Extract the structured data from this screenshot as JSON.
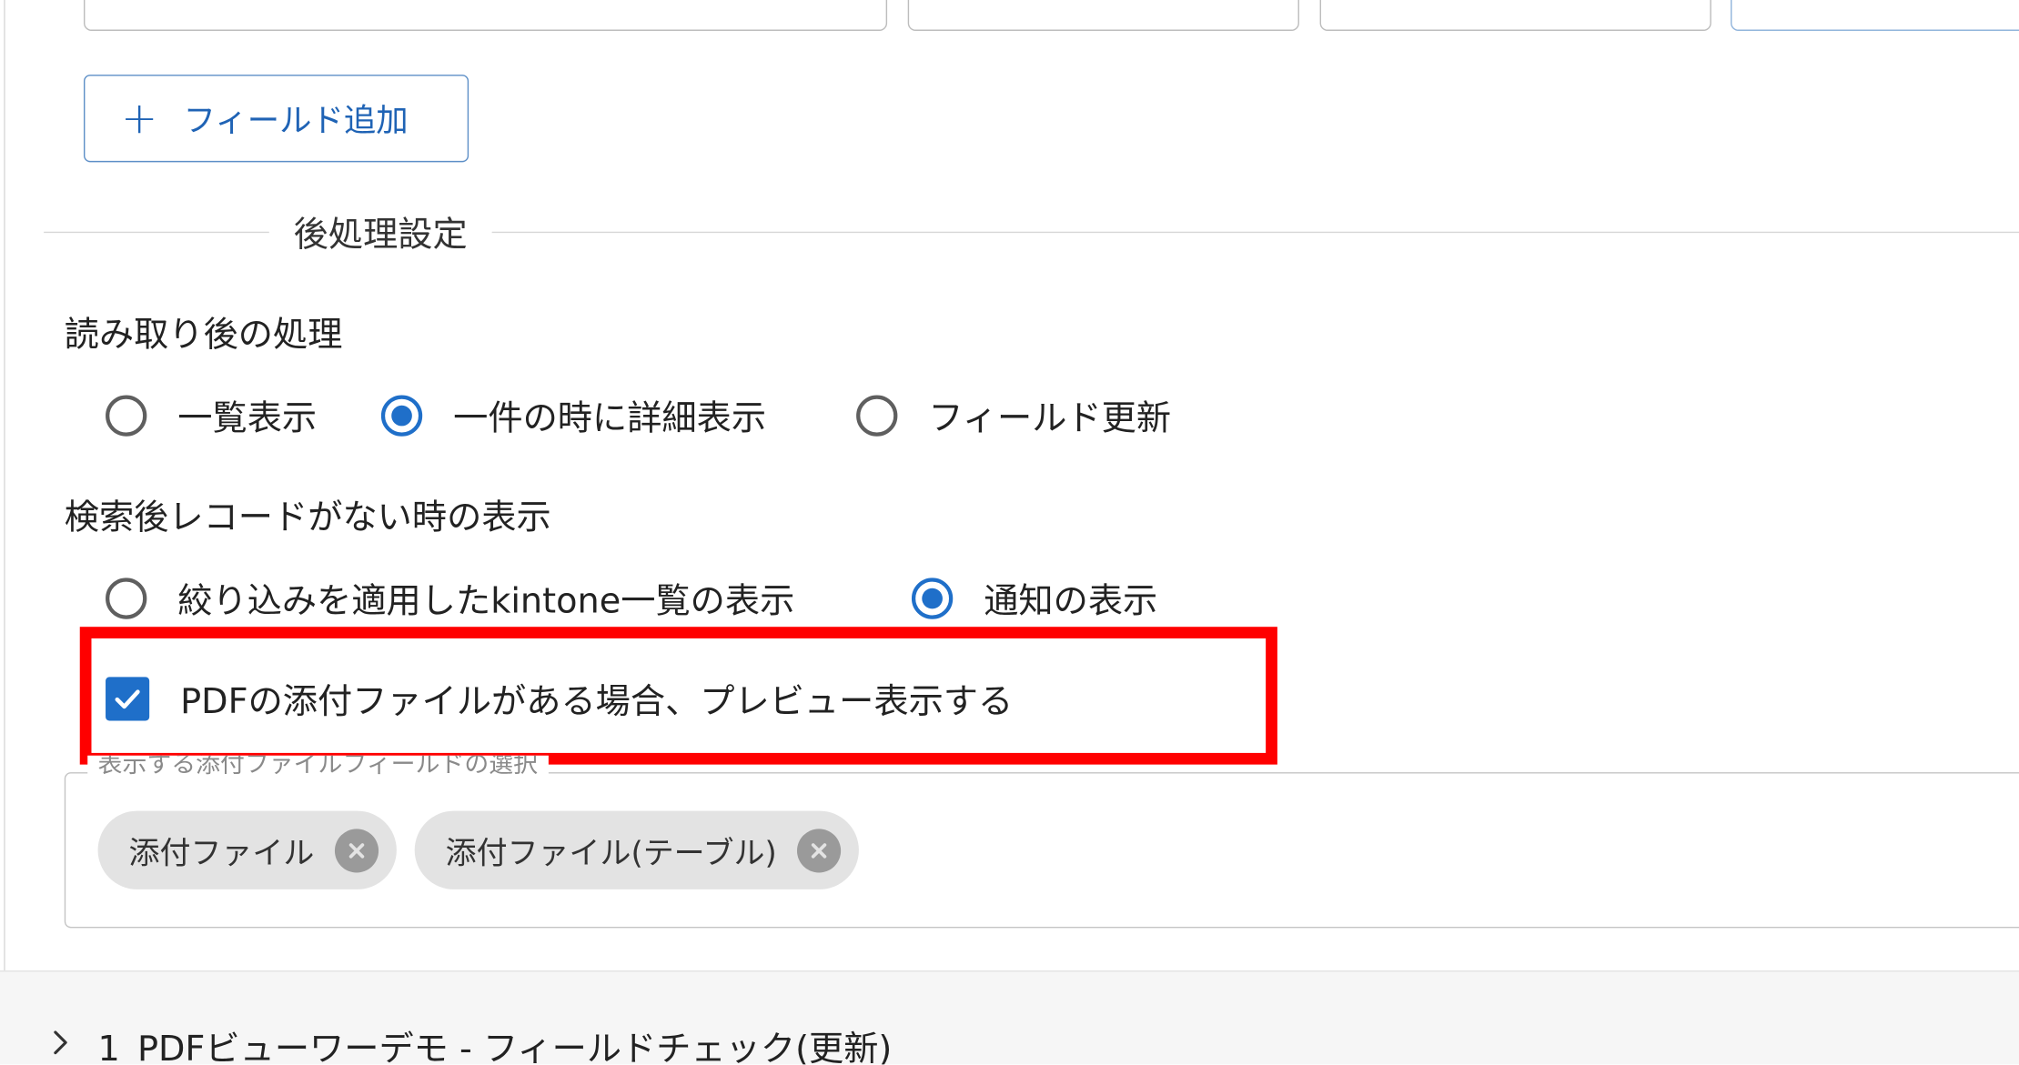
{
  "add_field_button": {
    "icon": "plus-icon",
    "label": "フィールド追加"
  },
  "post_processing": {
    "section_title": "後処理設定",
    "after_read": {
      "label": "読み取り後の処理",
      "options": [
        {
          "label": "一覧表示",
          "selected": false
        },
        {
          "label": "一件の時に詳細表示",
          "selected": true
        },
        {
          "label": "フィールド更新",
          "selected": false
        }
      ]
    },
    "no_record": {
      "label": "検索後レコードがない時の表示",
      "options": [
        {
          "label": "絞り込みを適用したkintone一覧の表示",
          "selected": false
        },
        {
          "label": "通知の表示",
          "selected": true
        }
      ]
    },
    "pdf_preview": {
      "label": "PDFの添付ファイルがある場合、プレビュー表示する",
      "checked": true
    },
    "attachment_select": {
      "legend": "表示する添付ファイルフィールドの選択",
      "chips": [
        {
          "label": "添付ファイル",
          "remove_icon": "cancel-circle-icon"
        },
        {
          "label": "添付ファイル(テーブル)",
          "remove_icon": "cancel-circle-icon"
        }
      ]
    }
  },
  "accordion": {
    "icon": "chevron-right-icon",
    "title": "1_PDFビューワーデモ - フィールドチェック(更新)"
  },
  "colors": {
    "accent": "#1f6fc9",
    "highlight": "#ff0000",
    "chip_bg": "#e3e3e3"
  }
}
